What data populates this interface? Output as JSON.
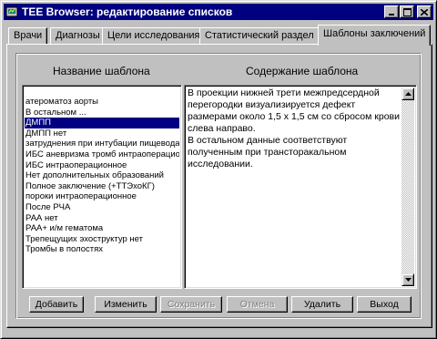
{
  "window": {
    "title": "TEE Browser: редактирование списков",
    "minimize_label": "_",
    "maximize_label": "□",
    "close_label": "×"
  },
  "tabs": [
    {
      "label": "Врачи"
    },
    {
      "label": "Диагнозы"
    },
    {
      "label": "Цели исследования"
    },
    {
      "label": "Статистический раздел"
    },
    {
      "label": "Шаблоны заключений"
    }
  ],
  "panel": {
    "list_header": "Название шаблона",
    "content_header": "Содержание шаблона",
    "selected_index": 2,
    "templates": [
      "атероматоз аорты",
      "В остальном ...",
      "ДМПП",
      "ДМПП нет",
      "затруднения при интубации пищевода",
      "ИБС аневризма тромб интраоперационно",
      "ИБС интраоперационное",
      "Нет дополнительных образований",
      "Полное заключение (+ТТЭхоКГ)",
      "пороки интраоперационное",
      "После РЧА",
      "РАА нет",
      "РАА+ и/м гематома",
      "Трепещущих эхоструктур нет",
      "Тромбы в полостях"
    ],
    "content_text": "В проекции нижней трети межпредсердной перегородки визуализируется дефект размерами около 1,5 х 1,5 см со сбросом крови слева направо.\nВ остальном данные соответствуют полученным при трансторакальном исследовании."
  },
  "buttons": {
    "add": "Добавить",
    "edit": "Изменить",
    "save": "Сохранить",
    "cancel": "Отмена",
    "delete": "Удалить",
    "exit": "Выход"
  }
}
